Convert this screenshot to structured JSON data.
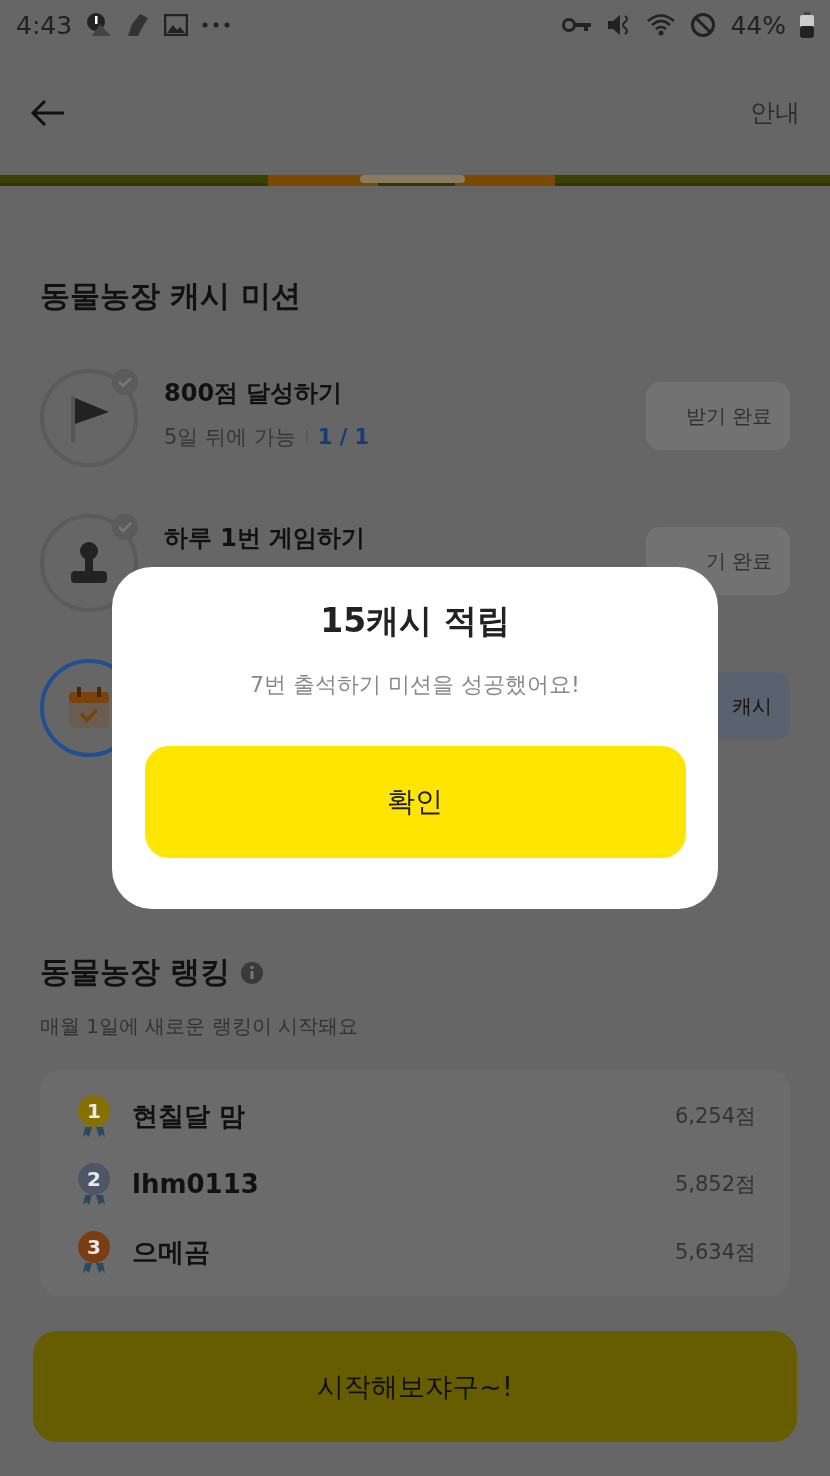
{
  "status_bar": {
    "time": "4:43",
    "battery": "44%"
  },
  "header": {
    "action": "안내"
  },
  "missions": {
    "title": "동물농장 캐시 미션",
    "items": [
      {
        "kind": "flag",
        "completed": true,
        "title": "800점 달성하기",
        "subtitle": "5일 뒤에 가능",
        "progress": "1 / 1",
        "button": "받기 완료"
      },
      {
        "kind": "joystick",
        "completed": true,
        "title": "하루 1번 게임하기",
        "button": "기 완료"
      },
      {
        "kind": "calendar",
        "completed": false,
        "button": "캐시"
      }
    ]
  },
  "ranking": {
    "title": "동물농장 랭킹",
    "subtitle": "매월 1일에 새로운 랭킹이 시작돼요",
    "rows": [
      {
        "rank": "1",
        "color": "#857000",
        "name": "현칠달 맘",
        "score": "6,254점"
      },
      {
        "rank": "2",
        "color": "#4d5666",
        "name": "lhm0113",
        "score": "5,852점"
      },
      {
        "rank": "3",
        "color": "#7a3d14",
        "name": "으메곰",
        "score": "5,634점"
      }
    ]
  },
  "start_button": "시작해보쟈구~!",
  "dialog": {
    "title": "15캐시 적립",
    "message": "7번 출석하기 미션을 성공했어요!",
    "confirm": "확인"
  }
}
